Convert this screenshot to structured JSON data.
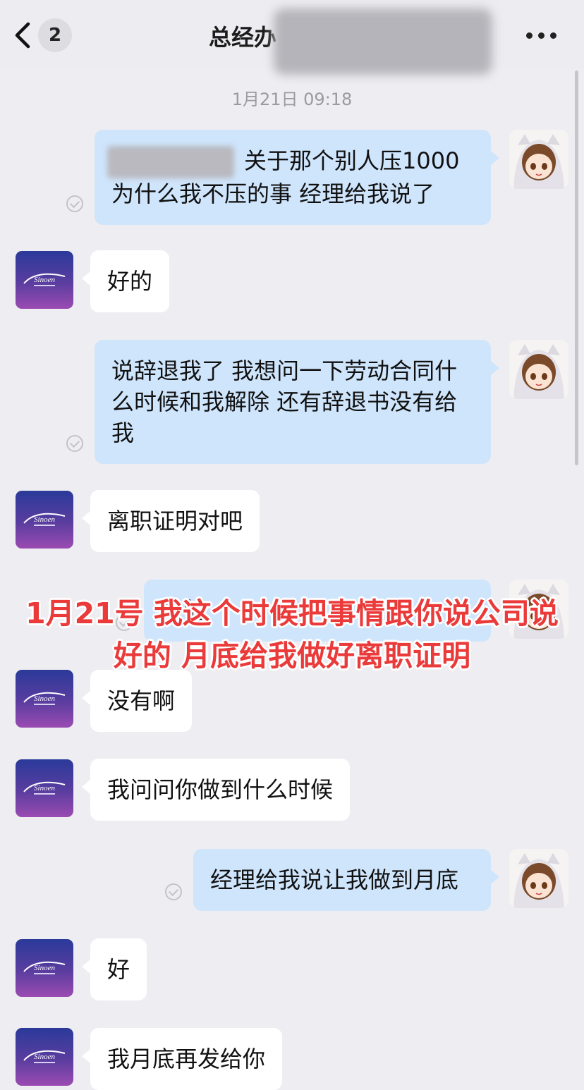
{
  "header": {
    "unread_count": "2",
    "title": "总经办"
  },
  "timestamp": "1月21日 09:18",
  "messages": [
    {
      "side": "out",
      "text": "关于那个别人压1000为什么我不压的事 经理给我说了"
    },
    {
      "side": "in",
      "text": "好的"
    },
    {
      "side": "out",
      "text": "说辞退我了 我想问一下劳动合同什么时候和我解除 还有辞退书没有给我"
    },
    {
      "side": "in",
      "text": "离职证明对吧"
    },
    {
      "side": "out",
      "text": "是的"
    },
    {
      "side": "in",
      "text": "没有啊"
    },
    {
      "side": "in",
      "text": "我问问你做到什么时候"
    },
    {
      "side": "out",
      "text": "经理给我说让我做到月底"
    },
    {
      "side": "in",
      "text": "好"
    },
    {
      "side": "in",
      "text": "我月底再发给你"
    }
  ],
  "overlay_caption": "1月21号 我这个时候把事情跟你说公司说 好的 月底给我做好离职证明",
  "colors": {
    "background": "#eeeef2",
    "outgoing_bubble": "#cfe5fc",
    "incoming_bubble": "#ffffff",
    "caption_red": "#ea3a3a"
  },
  "icons": {
    "back": "chevron-left-icon",
    "more": "more-dots-icon",
    "read_receipt": "check-circle-icon"
  }
}
